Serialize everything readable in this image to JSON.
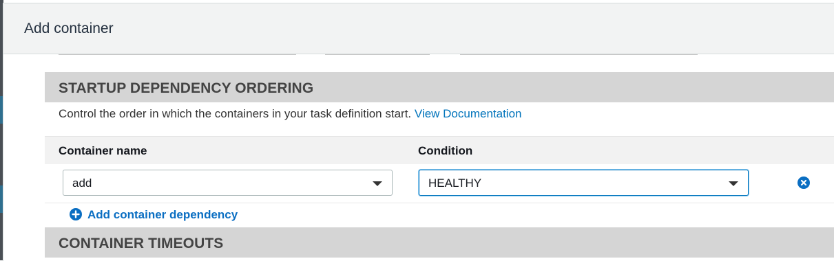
{
  "modal": {
    "title": "Add container"
  },
  "startup_section": {
    "title": "STARTUP DEPENDENCY ORDERING",
    "description": "Control the order in which the containers in your task definition start.",
    "doc_link": "View Documentation"
  },
  "dependency_table": {
    "columns": [
      "Container name",
      "Condition"
    ],
    "rows": [
      {
        "container_name": "add",
        "condition": "HEALTHY"
      }
    ],
    "add_label": "Add container dependency"
  },
  "timeouts_section": {
    "title": "CONTAINER TIMEOUTS"
  },
  "icons": {
    "dropdown": "chevron-down-icon",
    "remove": "remove-circle-icon",
    "add": "plus-circle-icon"
  },
  "colors": {
    "link": "#0073bb",
    "accent": "#0a6ec2",
    "section_bg": "#d5d5d5",
    "header_bg": "#f2f3f3"
  }
}
